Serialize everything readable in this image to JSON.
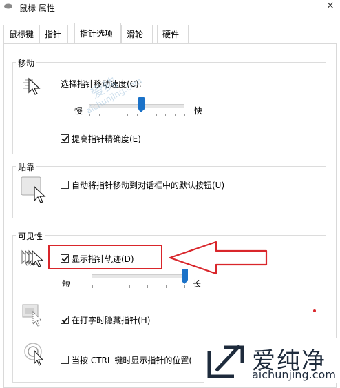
{
  "window": {
    "title": "鼠标 属性",
    "close_glyph": "×"
  },
  "tabs": [
    {
      "label": "鼠标键"
    },
    {
      "label": "指针"
    },
    {
      "label": "指针选项"
    },
    {
      "label": "滑轮"
    },
    {
      "label": "硬件"
    }
  ],
  "active_tab": "指针选项",
  "motion": {
    "title": "移动",
    "speed_label": "选择指针移动速度(C):",
    "slow_label": "慢",
    "fast_label": "快",
    "speed_level": 0.55,
    "precision_label": "提高指针精确度(E)",
    "precision_checked": true
  },
  "snap": {
    "title": "贴靠",
    "snap_label": "自动将指针移动到对话框中的默认按钮(U)",
    "snap_checked": false
  },
  "visibility": {
    "title": "可见性",
    "trails_label": "显示指针轨迹(D)",
    "trails_checked": true,
    "short_label": "短",
    "long_label": "长",
    "trail_level": 1.0,
    "hide_label": "在打字时隐藏指针(H)",
    "hide_checked": true,
    "ctrl_label": "当按 CTRL 键时显示指针的位置(",
    "ctrl_checked": false
  },
  "watermark": {
    "brand": "爱纯净",
    "url": "aichunjing.com",
    "faint_brand": "爱纯",
    "faint_url": "aichunjing.com"
  },
  "colors": {
    "accent": "#1b72c8",
    "annotation": "#d9262b"
  }
}
